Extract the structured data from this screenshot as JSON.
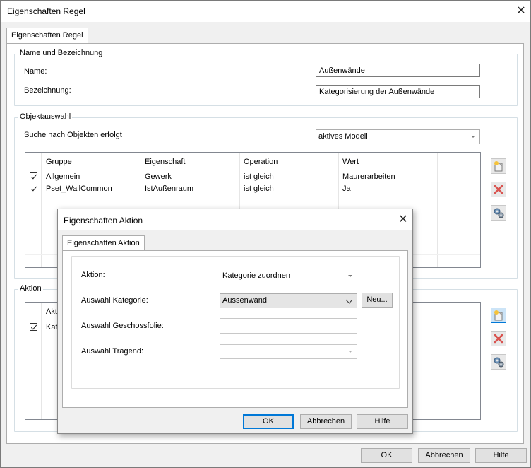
{
  "window": {
    "title": "Eigenschaften Regel",
    "tab": "Eigenschaften Regel",
    "footer": {
      "ok": "OK",
      "cancel": "Abbrechen",
      "help": "Hilfe"
    }
  },
  "name_group": {
    "legend": "Name und Bezeichnung",
    "name_label": "Name:",
    "name_value": "Außenwände",
    "desc_label": "Bezeichnung:",
    "desc_value": "Kategorisierung der Außenwände"
  },
  "object_group": {
    "legend": "Objektauswahl",
    "search_label": "Suche nach Objekten erfolgt",
    "search_value": "aktives Modell",
    "columns": [
      "Gruppe",
      "Eigenschaft",
      "Operation",
      "Wert"
    ],
    "rows": [
      {
        "checked": true,
        "group": "Allgemein",
        "property": "Gewerk",
        "operation": "ist gleich",
        "value": "Maurerarbeiten"
      },
      {
        "checked": true,
        "group": "Pset_WallCommon",
        "property": "IstAußenraum",
        "operation": "ist gleich",
        "value": "Ja"
      }
    ]
  },
  "action_group": {
    "legend": "Aktion",
    "column": "Akti",
    "row_text": "Kate"
  },
  "icons": {
    "add": "add-document-icon",
    "delete": "delete-x-icon",
    "settings": "gears-icon",
    "delete_color": "#d9534f"
  },
  "dialog": {
    "title": "Eigenschaften Aktion",
    "tab": "Eigenschaften Aktion",
    "action_label": "Aktion:",
    "action_value": "Kategorie zuordnen",
    "category_label": "Auswahl Kategorie:",
    "category_value": "Aussenwand",
    "new_button": "Neu...",
    "floor_label": "Auswahl Geschossfolie:",
    "floor_value": "",
    "bearing_label": "Auswahl Tragend:",
    "bearing_value": "",
    "ok": "OK",
    "cancel": "Abbrechen",
    "help": "Hilfe"
  }
}
